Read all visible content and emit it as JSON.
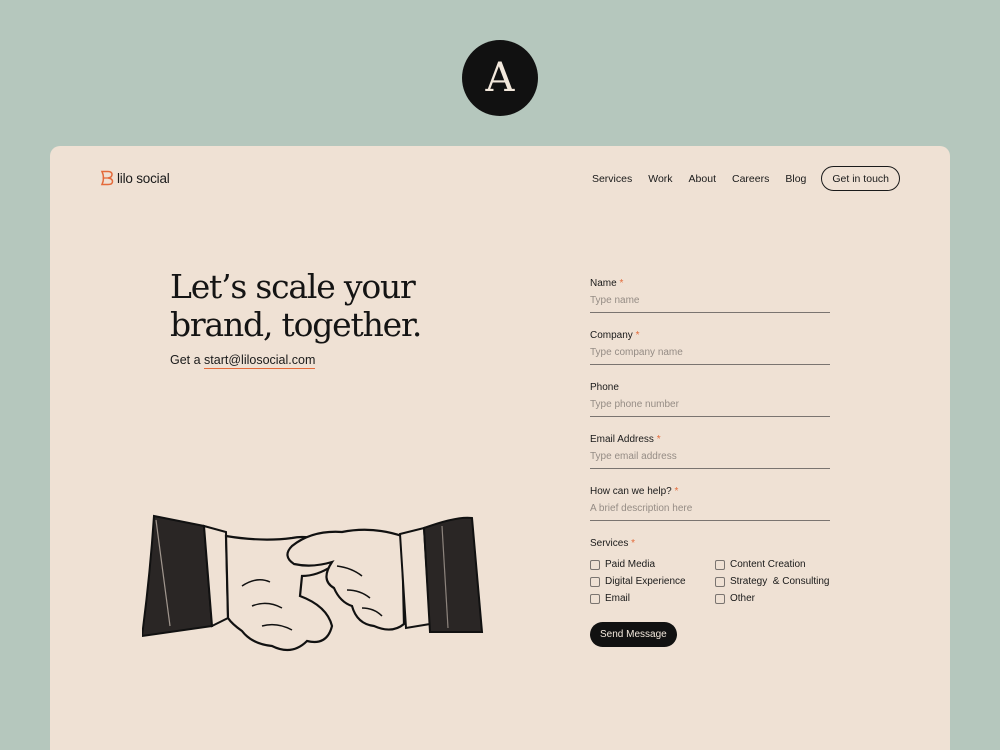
{
  "badge": {
    "letter": "A"
  },
  "logo": {
    "text": "lilo social",
    "accent_color": "#e46a3a"
  },
  "nav": {
    "links": [
      "Services",
      "Work",
      "About",
      "Careers",
      "Blog"
    ],
    "cta": "Get in touch"
  },
  "hero": {
    "title_line1": "Let’s scale your",
    "title_line2": "brand, together.",
    "sub_prefix": "Get a ",
    "email": "start@lilosocial.com"
  },
  "form": {
    "fields": [
      {
        "label": "Name",
        "required": "*",
        "placeholder": "Type name"
      },
      {
        "label": "Company",
        "required": "*",
        "placeholder": "Type company name"
      },
      {
        "label": "Phone",
        "required": "",
        "placeholder": "Type phone number"
      },
      {
        "label": "Email Address",
        "required": "*",
        "placeholder": "Type email address"
      },
      {
        "label": "How can we help?",
        "required": "*",
        "placeholder": "A brief description here"
      }
    ],
    "services_label": "Services",
    "services_required": "*",
    "services": [
      "Paid Media",
      "Content Creation",
      "Digital Experience",
      "Strategy  & Consulting",
      "Email",
      "Other"
    ],
    "submit": "Send Message"
  },
  "colors": {
    "page_bg": "#b5c7bd",
    "card_bg": "#efe1d4",
    "accent": "#e46a3a",
    "ink": "#111111"
  }
}
